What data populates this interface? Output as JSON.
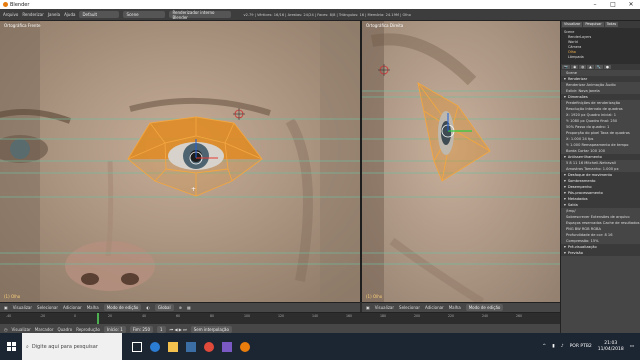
{
  "window": {
    "title": "Blender"
  },
  "info_bar": {
    "menus": [
      "Arquivo",
      "Renderizar",
      "Janela",
      "Ajuda"
    ],
    "screen": "Default",
    "scene": "Scene",
    "engine": "Renderizador interno Blender",
    "stats": "v2.79 | Vértices: 16/16 | Arestas: 24/24 | Faces: 8/8 | Triângulos: 16 | Memória: 24.19M | Olho"
  },
  "viewport_left": {
    "label": "Ortográfica Frente",
    "object_count": "(1) Olho"
  },
  "viewport_right": {
    "label": "Ortográfica Direita",
    "object_count": "(1) Olho"
  },
  "header_left": {
    "items": [
      "Visualizar",
      "Selecionar",
      "Adicionar",
      "Malha"
    ],
    "mode": "Modo de edição",
    "pivot": "Global"
  },
  "header_right": {
    "items": [
      "Visualizar",
      "Selecionar",
      "Adicionar",
      "Malha"
    ],
    "mode": "Modo de edição"
  },
  "timeline": {
    "items": [
      "Visualizar",
      "Marcador",
      "Quadro",
      "Reprodução"
    ],
    "start_label": "Início:",
    "start": "1",
    "end_label": "Fim:",
    "end": "250",
    "current": "1",
    "keying": "Sem interpolação",
    "ticks": [
      "-40",
      "-20",
      "0",
      "20",
      "40",
      "60",
      "80",
      "100",
      "120",
      "140",
      "160",
      "180",
      "200",
      "220",
      "240",
      "260"
    ]
  },
  "properties": {
    "tabs": [
      "Visualizar",
      "Pesquisar",
      "Todas"
    ],
    "outliner": [
      "Scene",
      "RenderLayers",
      "World",
      "Câmera",
      "Olho",
      "Lâmpada"
    ],
    "rows": [
      {
        "label": "Scene"
      },
      {
        "label": "Renderizar",
        "hdr": true
      },
      {
        "label": "Renderizar  Animação  Áudio"
      },
      {
        "label": "Exibir:  Nova janela"
      },
      {
        "label": "Dimensões",
        "hdr": true
      },
      {
        "label": "Predefinições de renderização"
      },
      {
        "label": "Resolução   Intervalo de quadros"
      },
      {
        "label": "X: 1920 px   Quadro inicial: 1"
      },
      {
        "label": "Y: 1080 px   Quadro final: 250"
      },
      {
        "label": "50%   Passo do quadro: 1"
      },
      {
        "label": "Proporção do pixel   Taxa de quadros"
      },
      {
        "label": "X: 1.000   24 fps"
      },
      {
        "label": "Y: 1.000   Remapeamento de tempo"
      },
      {
        "label": "Borda   Cortar   100   100"
      },
      {
        "label": "Antisserrilhamento",
        "hdr": true
      },
      {
        "label": "5  8  11  16   Mitchell-Netravali"
      },
      {
        "label": "Amostras   Tamanho: 1.000 px"
      },
      {
        "label": "Desfoque de movimento",
        "hdr": true
      },
      {
        "label": "Sombreamento",
        "hdr": true
      },
      {
        "label": "Desempenho",
        "hdr": true
      },
      {
        "label": "Pós-processamento",
        "hdr": true
      },
      {
        "label": "Metadados",
        "hdr": true
      },
      {
        "label": "Saída",
        "hdr": true
      },
      {
        "label": "/tmp/"
      },
      {
        "label": "Sobrescrever   Extensões de arquivo"
      },
      {
        "label": "Espaços reservados   Cache de resultados"
      },
      {
        "label": "PNG   BW  RGB  RGBA"
      },
      {
        "label": "Profundidade de cor: 8  16"
      },
      {
        "label": "Compressão: 15%"
      },
      {
        "label": "Pré-visualização",
        "hdr": true
      },
      {
        "label": "Previsão",
        "hdr": true
      }
    ]
  },
  "taskbar": {
    "search_placeholder": "Digite aqui para pesquisar",
    "language": "POR PTB2",
    "time": "21:03",
    "date": "11/04/2018"
  },
  "colors": {
    "mesh": "#e08a1e",
    "accent": "#5680c2",
    "grid_line": "#6fbfa0"
  }
}
